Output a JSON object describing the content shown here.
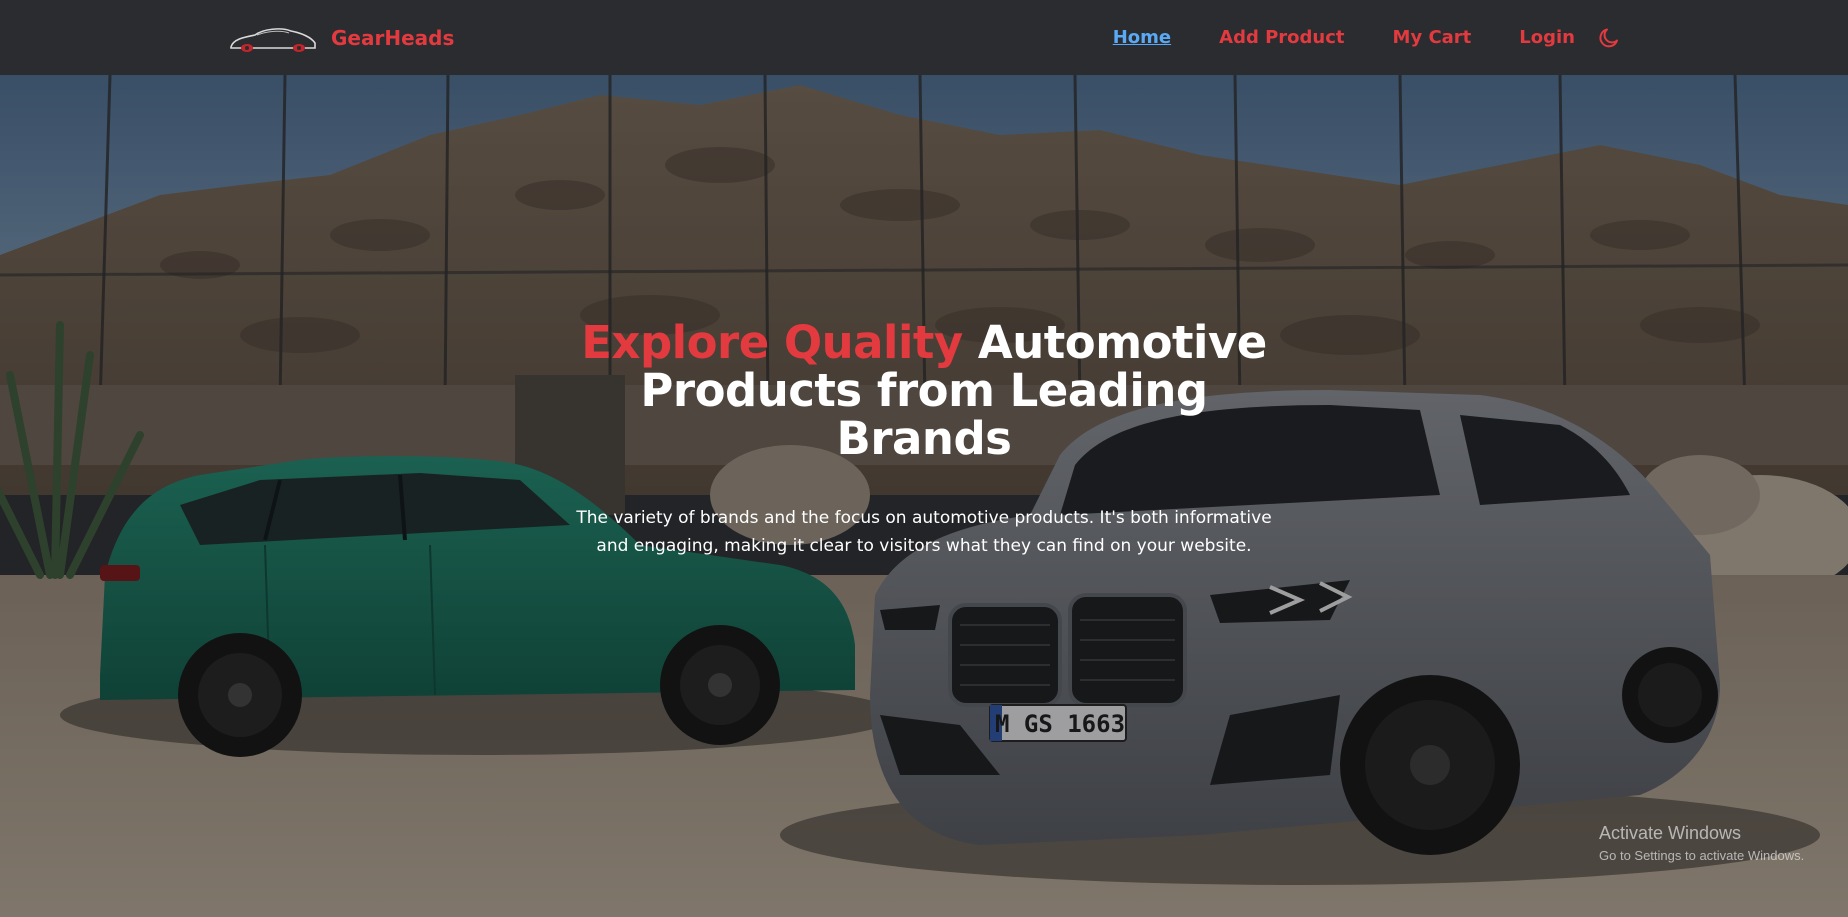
{
  "brand": {
    "name": "GearHeads",
    "logo": "car-logo-icon"
  },
  "nav": {
    "items": [
      {
        "label": "Home",
        "active": true
      },
      {
        "label": "Add Product",
        "active": false
      },
      {
        "label": "My Cart",
        "active": false
      },
      {
        "label": "Login",
        "active": false
      }
    ],
    "theme_toggle_icon": "moon-icon"
  },
  "hero": {
    "headline_accent": "Explore Quality",
    "headline_rest": " Automotive Products from Leading Brands",
    "subtext": "The variety of brands and the focus on automotive products. It's both informative and engaging, making it clear to visitors what they can find on your website.",
    "background": "hero-background-image"
  },
  "watermark": {
    "title": "Activate Windows",
    "subtitle": "Go to Settings to activate Windows."
  },
  "colors": {
    "accent": "#e23a3f",
    "active_link": "#5aa9f5",
    "navbar_bg": "#2a2c30"
  }
}
